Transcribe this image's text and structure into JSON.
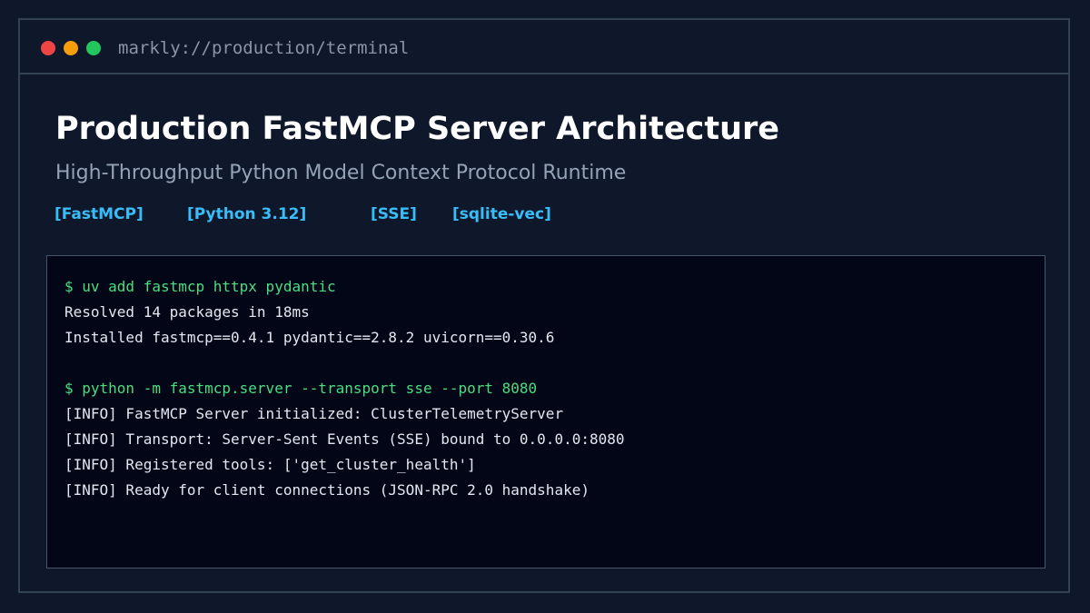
{
  "window": {
    "url": "markly://production/terminal",
    "controls": {
      "close_color": "#ef4444",
      "minimize_color": "#f59e0b",
      "maximize_color": "#22c55e"
    }
  },
  "header": {
    "title": "Production FastMCP Server Architecture",
    "subtitle": "High-Throughput Python Model Context Protocol Runtime",
    "tags": [
      "[FastMCP]",
      "[Python 3.12]",
      "[SSE]",
      "[sqlite-vec]"
    ]
  },
  "terminal": {
    "lines": [
      {
        "kind": "command",
        "text": "$ uv add fastmcp httpx pydantic"
      },
      {
        "kind": "output",
        "text": "Resolved 14 packages in 18ms"
      },
      {
        "kind": "output",
        "text": "Installed fastmcp==0.4.1 pydantic==2.8.2 uvicorn==0.30.6"
      },
      {
        "kind": "command",
        "text": "$ python -m fastmcp.server --transport sse --port 8080"
      },
      {
        "kind": "output",
        "text": "[INFO] FastMCP Server initialized: ClusterTelemetryServer"
      },
      {
        "kind": "output",
        "text": "[INFO] Transport: Server-Sent Events (SSE) bound to 0.0.0.0:8080"
      },
      {
        "kind": "output",
        "text": "[INFO] Registered tools: ['get_cluster_health']"
      },
      {
        "kind": "output",
        "text": "[INFO] Ready for client connections (JSON-RPC 2.0 handshake)"
      }
    ]
  },
  "colors": {
    "background": "#0f172a",
    "border": "#334155",
    "accent": "#38bdf8",
    "command": "#4ade80",
    "output": "#e2e8f0"
  }
}
